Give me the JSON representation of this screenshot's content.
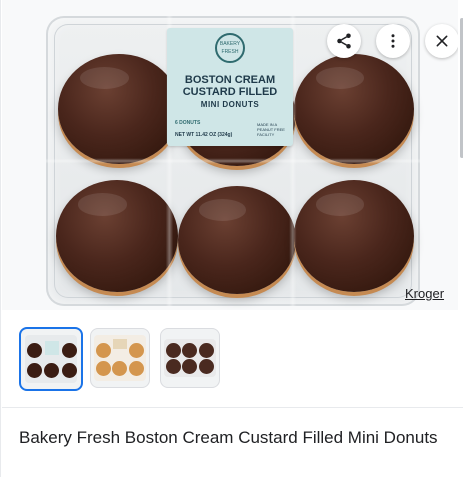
{
  "product_image": {
    "label": {
      "badge_text": "BAKERY FRESH",
      "title": "BOSTON CREAM CUSTARD FILLED",
      "subtitle": "MINI DONUTS",
      "count": "6 DONUTS",
      "net_weight": "NET WT 11.42 OZ (324g)",
      "facility_note": "MADE IN A PEANUT FREE FACILITY"
    },
    "source_link": "Kroger"
  },
  "actions": {
    "share_icon": "share-icon",
    "more_icon": "more-vert-icon",
    "close_icon": "close-icon"
  },
  "thumbnails": {
    "selected_index": 0,
    "count": 3
  },
  "product_title": "Bakery Fresh Boston Cream Custard Filled Mini Donuts",
  "colors": {
    "accent": "#1a73e8",
    "text": "#202124",
    "glaze": "#3b1d13",
    "label_bg": "#cfe6e7"
  }
}
